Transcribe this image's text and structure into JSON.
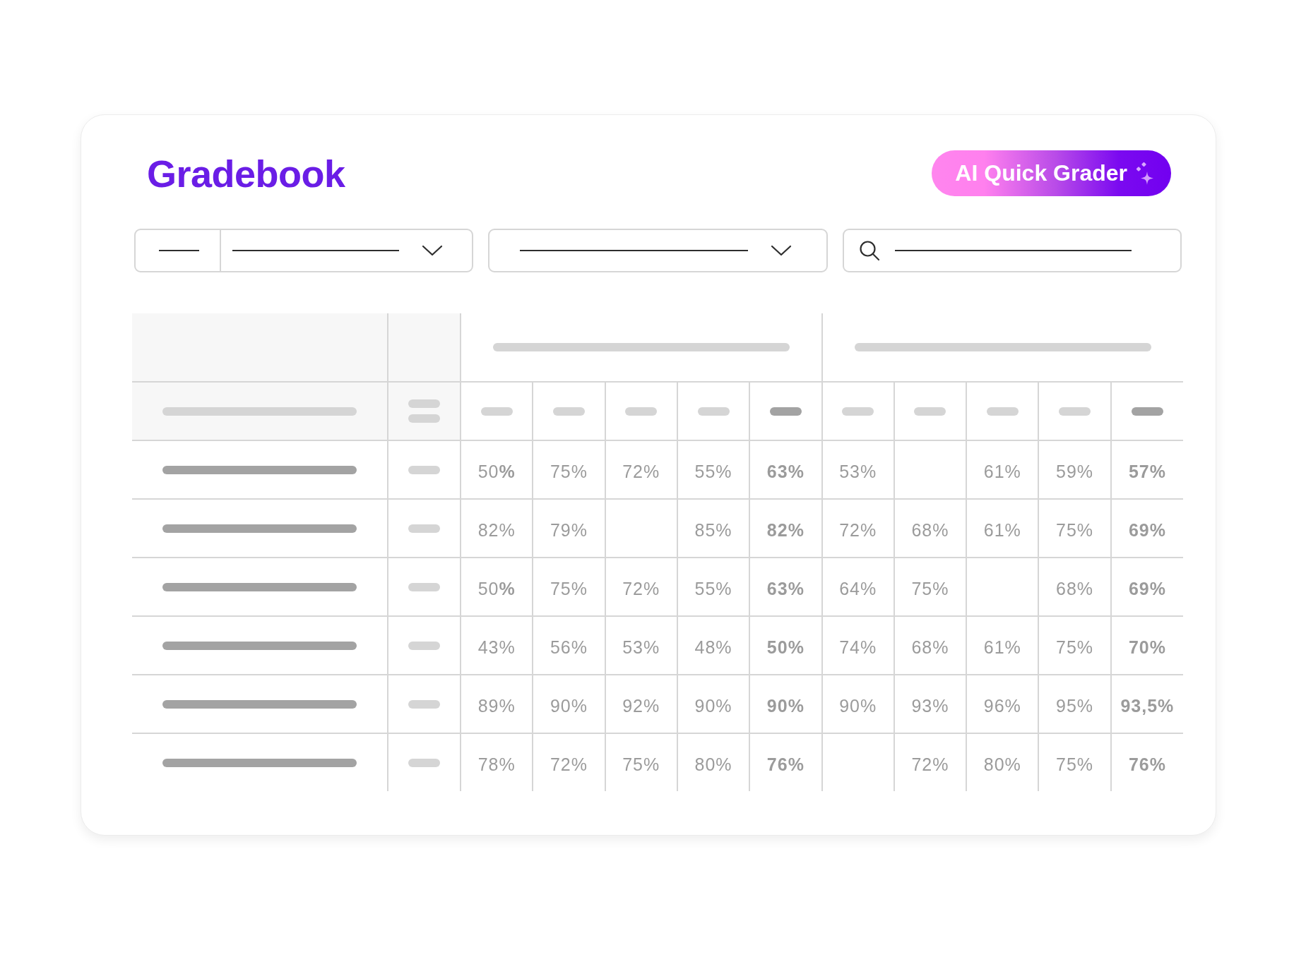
{
  "header": {
    "title": "Gradebook",
    "action": {
      "label": "AI Quick Grader"
    }
  },
  "filters": [
    {
      "kind": "split-select"
    },
    {
      "kind": "select"
    },
    {
      "kind": "search"
    }
  ],
  "table": {
    "groups": [
      {
        "columns": [
          {
            "kind": "score"
          },
          {
            "kind": "score"
          },
          {
            "kind": "score"
          },
          {
            "kind": "score"
          },
          {
            "kind": "average"
          }
        ]
      },
      {
        "columns": [
          {
            "kind": "score"
          },
          {
            "kind": "score"
          },
          {
            "kind": "score"
          },
          {
            "kind": "score"
          },
          {
            "kind": "average"
          }
        ]
      }
    ],
    "rows": [
      {
        "cells": [
          "50**%**",
          "75%",
          "72%",
          "55%",
          "63%",
          "53%",
          null,
          "61%",
          "59%",
          "57%"
        ]
      },
      {
        "cells": [
          "82%",
          "79%",
          null,
          "85%",
          "82%",
          "72%",
          "68%",
          "61%",
          "75%",
          "69%"
        ]
      },
      {
        "cells": [
          "50**%**",
          "75%",
          "72%",
          "55%",
          "63%",
          "64%",
          "75%",
          null,
          "68%",
          "69%"
        ]
      },
      {
        "cells": [
          "43%",
          "56%",
          "53%",
          "48%",
          "50%",
          "74%",
          "68%",
          "61%",
          "75%",
          "70%"
        ]
      },
      {
        "cells": [
          "89%",
          "90%",
          "92%",
          "90%",
          "90%",
          "90%",
          "93%",
          "96%",
          "95%",
          "93,5%"
        ]
      },
      {
        "cells": [
          "78%",
          "72%",
          "75%",
          "80%",
          "76%",
          null,
          "72%",
          "80%",
          "75%",
          "76%"
        ]
      }
    ]
  }
}
